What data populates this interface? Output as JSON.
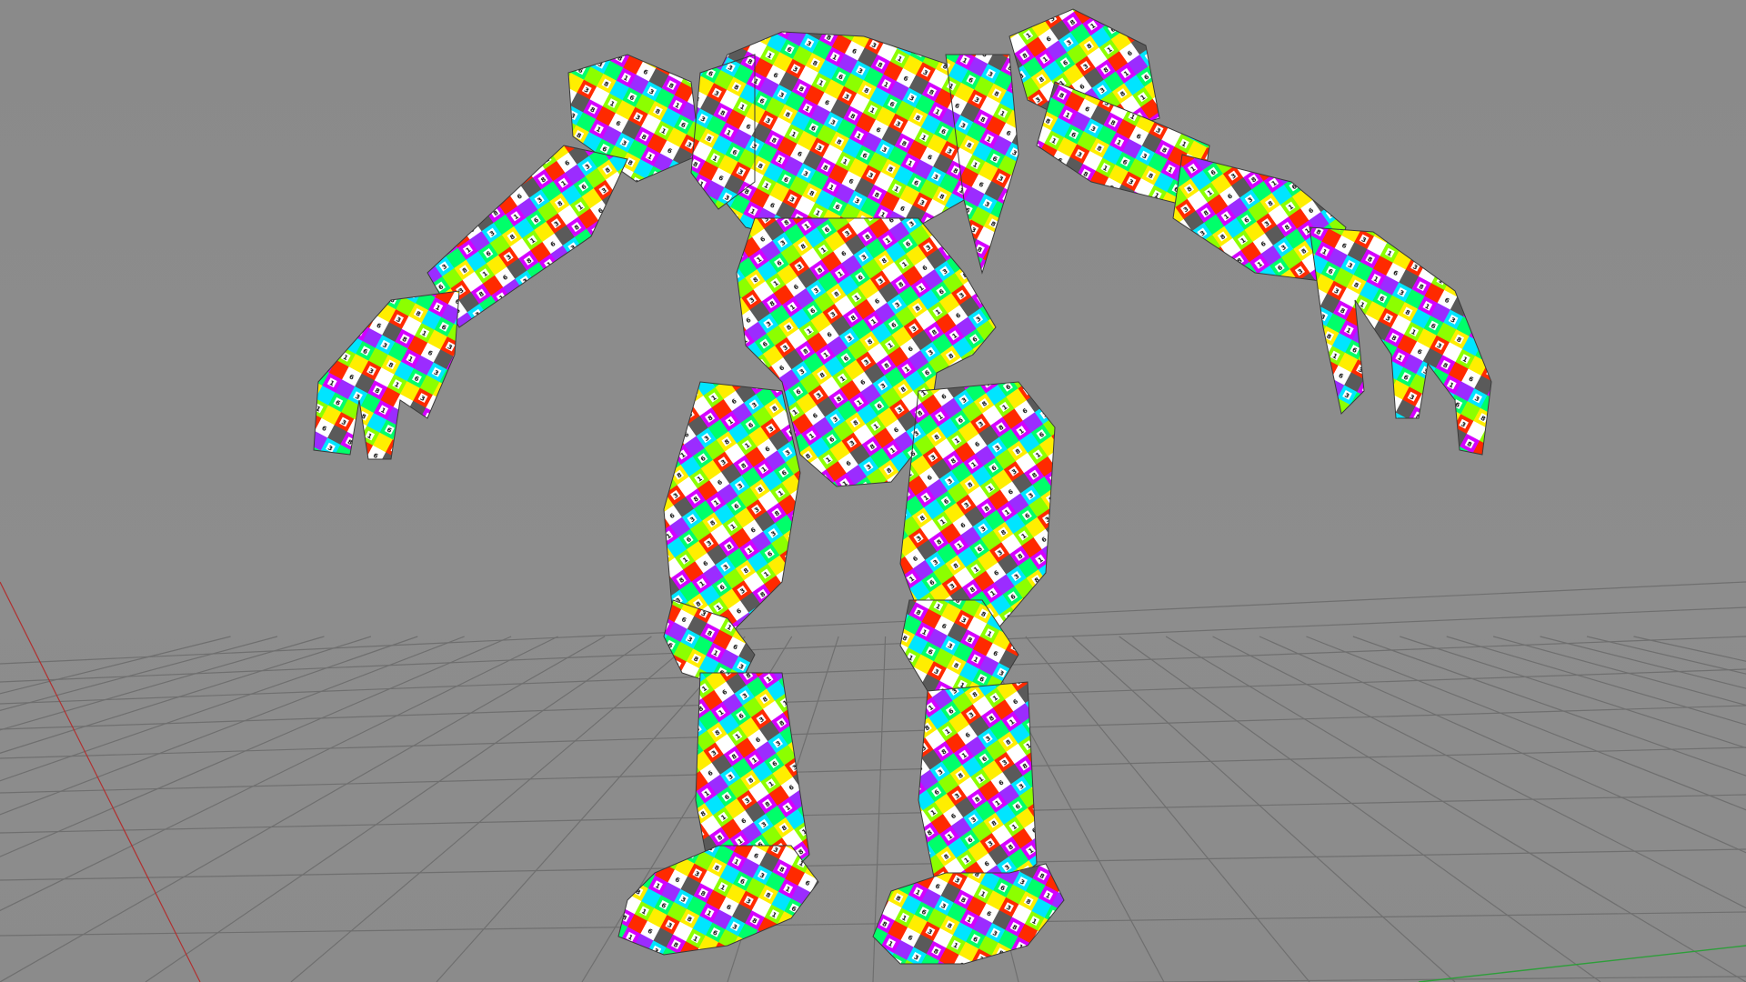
{
  "viewport": {
    "background_color": "#8a8a8a",
    "grid_line_color": "#6f6f6f",
    "x_axis_color": "#b03030",
    "z_axis_color": "#2e9e3a"
  },
  "model": {
    "texture": "uv-checker-numbered",
    "checker_colors": [
      "#d400ff",
      "#9b2cff",
      "#00e5ff",
      "#00ff6a",
      "#8cff00",
      "#ffee00",
      "#ff2a00",
      "#ffffff",
      "#5a5a5a"
    ],
    "checker_numbers": [
      "1",
      "2",
      "3",
      "4",
      "5",
      "6",
      "7",
      "8"
    ]
  }
}
